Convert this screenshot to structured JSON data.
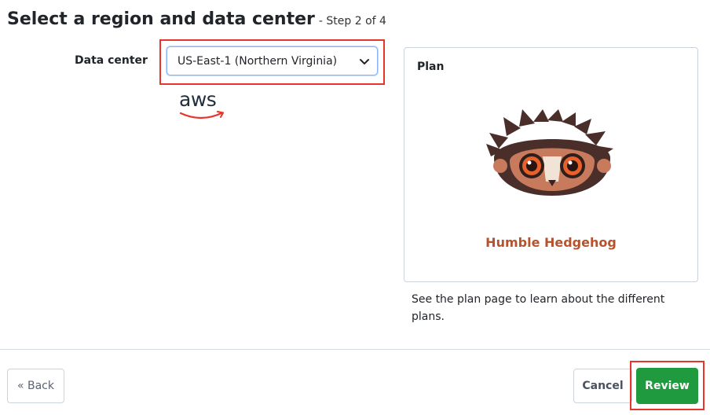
{
  "header": {
    "title": "Select a region and data center",
    "step": "- Step 2 of 4"
  },
  "form": {
    "data_center_label": "Data center",
    "data_center_value": "US-East-1 (Northern Virginia)",
    "provider_logo": "aws"
  },
  "plan": {
    "title": "Plan",
    "name": "Humble Hedgehog",
    "help_text": "See the plan page to learn about the different plans."
  },
  "footer": {
    "back_label": "« Back",
    "cancel_label": "Cancel",
    "review_label": "Review"
  },
  "colors": {
    "highlight": "#e8352a",
    "review_button": "#1f9a3e",
    "plan_name": "#b5532e"
  },
  "icons": {
    "select_chevron": "chevron-down-icon",
    "plan_image": "hedgehog-icon"
  }
}
